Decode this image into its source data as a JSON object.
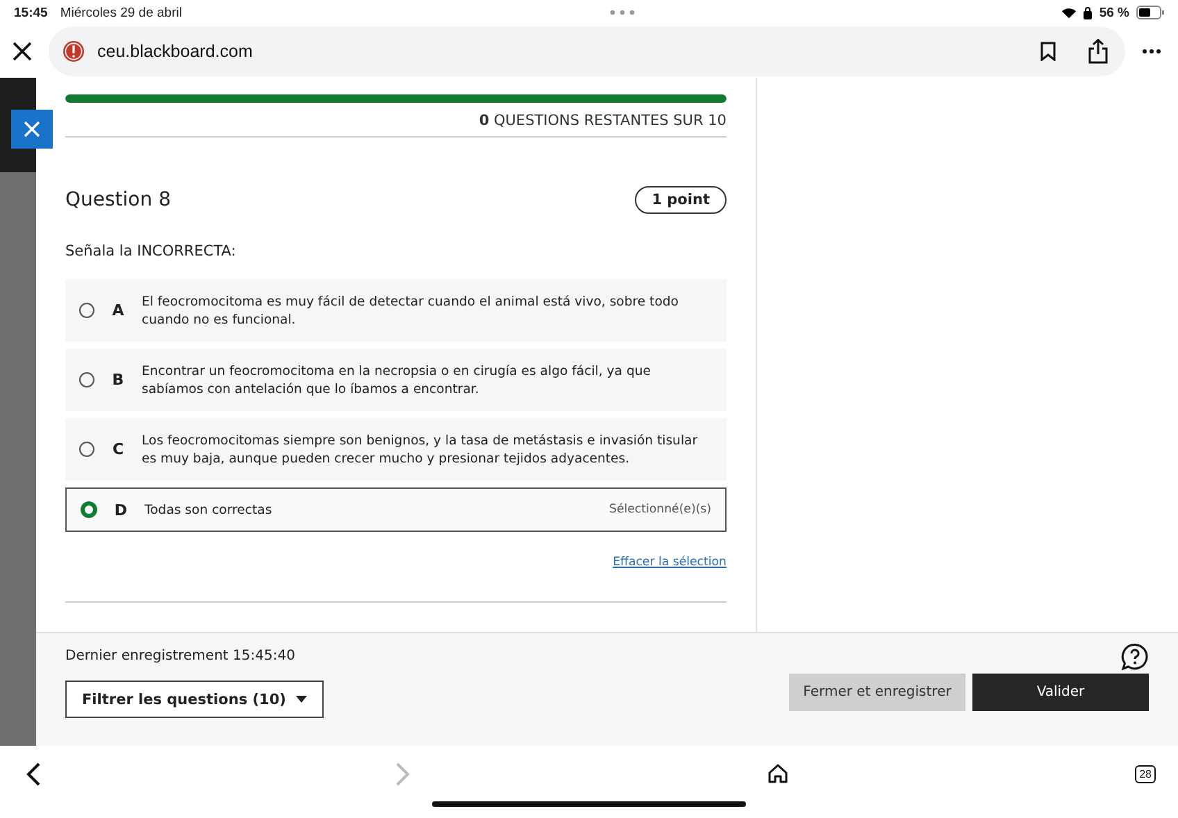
{
  "status_bar": {
    "time": "15:45",
    "date": "Miércoles 29 de abril",
    "battery": "56 %"
  },
  "browser": {
    "url": "ceu.blackboard.com",
    "tab_count": "28"
  },
  "progress": {
    "level": 1,
    "label": "**0** QUESTIONS RESTANTES SUR 10"
  },
  "question": {
    "title": "Question 8",
    "points": "1 point",
    "prompt": "Señala la INCORRECTA:",
    "options": [
      {
        "letter": "A",
        "text": "El feocromocitoma es muy fácil de detectar cuando el animal está vivo, sobre todo cuando no es funcional.",
        "selected": false
      },
      {
        "letter": "B",
        "text": "Encontrar un feocromocitoma en la necropsia o en cirugía es algo fácil, ya que sabíamos con antelación que lo íbamos a encontrar.",
        "selected": false
      },
      {
        "letter": "C",
        "text": "Los feocromocitomas siempre son benignos, y la tasa de metástasis e invasión tisular es muy baja, aunque pueden crecer mucho y presionar tejidos adyacentes.",
        "selected": false
      },
      {
        "letter": "D",
        "text": "Todas son correctas",
        "selected": true,
        "status_label": "Sélectionné(e)(s)"
      }
    ],
    "clear_link": "Effacer la sélection"
  },
  "footer": {
    "last_saved": "Dernier enregistrement 15:45:40",
    "filter_button": "Filtrer les questions (10)",
    "buttons": [
      {
        "label": "Fermer et enregistrer",
        "kind": "secondary"
      },
      {
        "label": "Valider",
        "kind": "primary"
      }
    ]
  }
}
